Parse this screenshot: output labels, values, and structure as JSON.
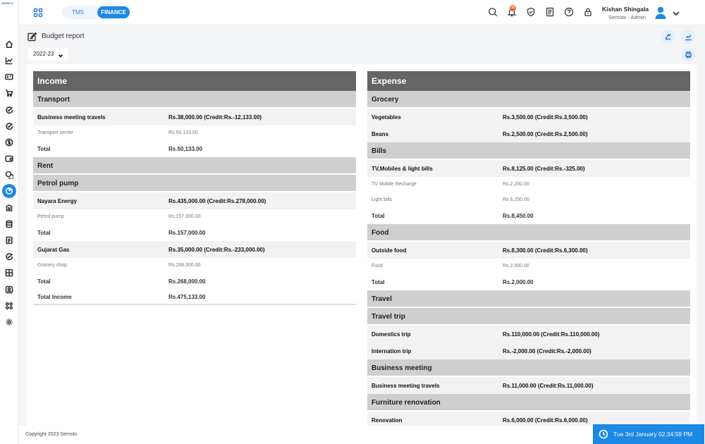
{
  "brand": {
    "logo_text": "SEMSTO"
  },
  "header": {
    "modules": {
      "tms": "TMS",
      "finance": "FINANCE"
    },
    "notification_count": "10",
    "user_name": "Kishan Shingala",
    "user_role": "Semsto - Admin"
  },
  "page": {
    "title": "Budget report",
    "year": "2022-23"
  },
  "income": {
    "title": "Income",
    "rows": [
      {
        "type": "sec",
        "label": "Transport"
      },
      {
        "type": "item",
        "label": "Business meeting travels",
        "value": "Rs.38,000.00 (Credit:Rs.-12,133.00)"
      },
      {
        "type": "sub",
        "label": "Transport sector",
        "value": "Rs.50,133.00"
      },
      {
        "type": "tot",
        "label": "Total",
        "value": "Rs.50,133.00"
      },
      {
        "type": "sec",
        "label": "Rent"
      },
      {
        "type": "sec",
        "label": "Petrol pump"
      },
      {
        "type": "item",
        "label": "Nayara Energy",
        "value": "Rs.435,000.00 (Credit:Rs.278,000.00)"
      },
      {
        "type": "sub",
        "label": "Petrol pump",
        "value": "Rs.157,000.00"
      },
      {
        "type": "tot",
        "label": "Total",
        "value": "Rs.157,000.00"
      },
      {
        "type": "item",
        "label": "Gujarat Gas",
        "value": "Rs.35,000.00 (Credit:Rs.-233,000.00)"
      },
      {
        "type": "sub",
        "label": "Grocery shop",
        "value": "Rs.268,000.00"
      },
      {
        "type": "tot",
        "label": "Total",
        "value": "Rs.268,000.00"
      },
      {
        "type": "grand",
        "label": "Total Income",
        "value": "Rs.475,133.00"
      }
    ]
  },
  "expense": {
    "title": "Expense",
    "rows": [
      {
        "type": "sec",
        "label": "Grocery"
      },
      {
        "type": "item",
        "label": "Vegetables",
        "value": "Rs.3,500.00 (Credit:Rs.3,500.00)"
      },
      {
        "type": "item",
        "label": "Beans",
        "value": "Rs.2,500.00 (Credit:Rs.2,500.00)"
      },
      {
        "type": "sec",
        "label": "Bills"
      },
      {
        "type": "item",
        "label": "TV,Mobiles & light bills",
        "value": "Rs.8,125.00 (Credit:Rs.-325.00)"
      },
      {
        "type": "sub",
        "label": "TV Mobile Recharge",
        "value": "Rs.2,200.00"
      },
      {
        "type": "sub",
        "label": "Light bills",
        "value": "Rs.6,250.00"
      },
      {
        "type": "tot",
        "label": "Total",
        "value": "Rs.8,450.00"
      },
      {
        "type": "sec",
        "label": "Food"
      },
      {
        "type": "item",
        "label": "Outside food",
        "value": "Rs.8,300.00 (Credit:Rs.6,300.00)"
      },
      {
        "type": "sub",
        "label": "Food",
        "value": "Rs.2,000.00"
      },
      {
        "type": "tot",
        "label": "Total",
        "value": "Rs.2,000.00"
      },
      {
        "type": "sec",
        "label": "Travel"
      },
      {
        "type": "sec",
        "label": "Travel trip"
      },
      {
        "type": "item",
        "label": "Domestics trip",
        "value": "Rs.110,000.00 (Credit:Rs.110,000.00)"
      },
      {
        "type": "item",
        "label": "Internation trip",
        "value": "Rs.-2,000.00 (Credit:Rs.-2,000.00)"
      },
      {
        "type": "sec",
        "label": "Business meeting"
      },
      {
        "type": "item",
        "label": "Business meeting travels",
        "value": "Rs.11,000.00 (Credit:Rs.11,000.00)"
      },
      {
        "type": "sec",
        "label": "Furniture renovation"
      },
      {
        "type": "item",
        "label": "Renovation",
        "value": "Rs.6,000.00 (Credit:Rs.6,000.00)"
      }
    ]
  },
  "footer": {
    "copyright": "Copyright 2023 Semsto",
    "datetime": "Tue 3rd January 02:34:59 PM"
  },
  "colors": {
    "accent": "#1e88e5",
    "section_header": "#656565",
    "category": "#cfcfcf",
    "item_bg": "#f2f2f2"
  },
  "sidebar_icons": [
    "home-icon",
    "chart-icon",
    "id-card-icon",
    "cart-icon",
    "check-circle-icon",
    "check-circle-icon",
    "dollar-icon",
    "wallet-icon",
    "coins-icon",
    "budget-icon",
    "bank-icon",
    "database-icon",
    "document-icon",
    "check-circle-icon",
    "building-icon",
    "user-icon",
    "apps-icon",
    "settings-icon"
  ]
}
